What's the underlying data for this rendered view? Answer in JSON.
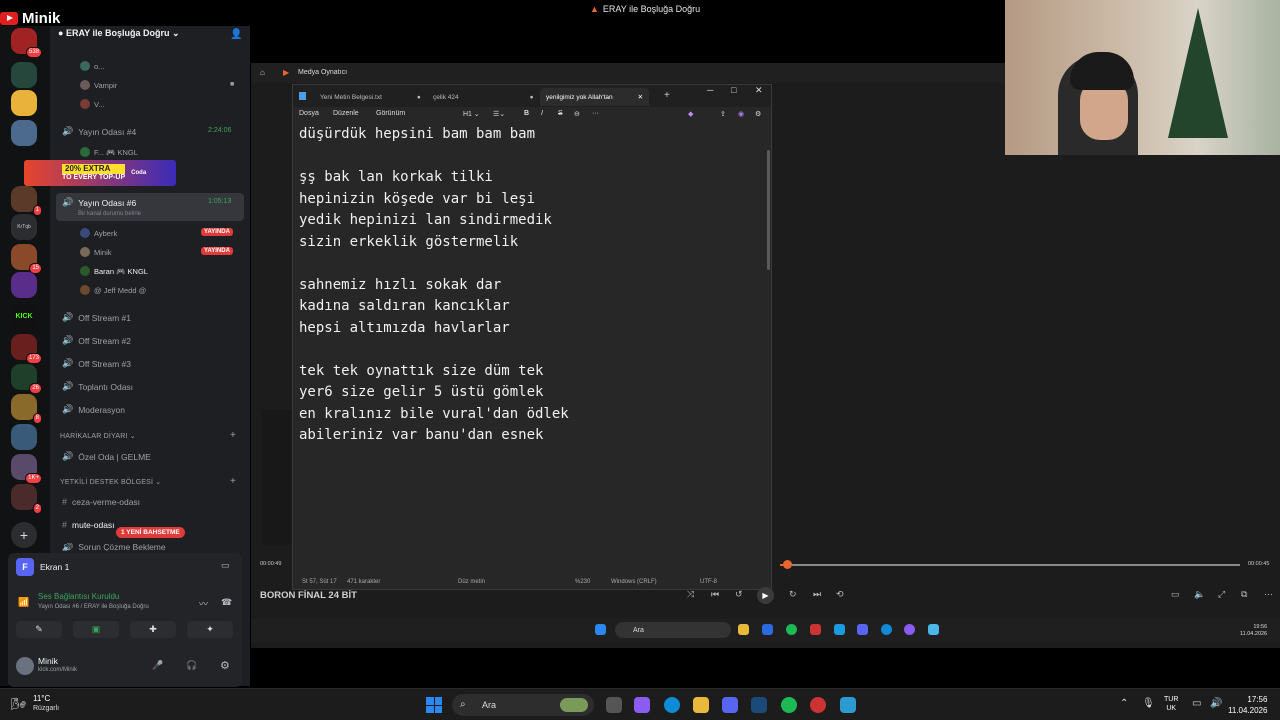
{
  "youtube": {
    "label": "Minik"
  },
  "window_title": "ERAY ile Boşluğa Doğru",
  "discord": {
    "server_name": "ERAY ile Boşluğa Doğru",
    "server_badges": [
      "538",
      "1",
      "15",
      "2",
      "173",
      "26",
      "8",
      "1K+",
      "2"
    ],
    "channels_top_users": [
      "o...",
      "Vampir",
      "V..."
    ],
    "yayin4": {
      "name": "Yayın Odası #4",
      "time": "2:24:06",
      "user": "F... 🎮 KNGL"
    },
    "promo": {
      "big": "20% EXTRA",
      "small": "TO EVERY TOP-UP",
      "brand": "Coda"
    },
    "yayin6": {
      "name": "Yayın Odası #6",
      "time": "1:05:13",
      "status": "Bir kanal durumu belirle"
    },
    "users": [
      {
        "name": "Ayberk",
        "live": "YAYINDA"
      },
      {
        "name": "Minik",
        "live": "YAYINDA"
      },
      {
        "name": "Baran 🎮 KNGL",
        "live": ""
      },
      {
        "name": "@ Jeff Medd @",
        "live": ""
      }
    ],
    "channels": [
      "Off Stream #1",
      "Off Stream #2",
      "Off Stream #3",
      "Toplantı Odası",
      "Moderasyon"
    ],
    "cat1": "HARİKALAR DİYARI",
    "ozel": "Özel Oda | GELME",
    "cat2": "YETKİLİ DESTEK BÖLGESİ",
    "text_channels": [
      "ceza-verme-odası",
      "mute-odası",
      "Sorun Çözme Bekleme"
    ],
    "mute_pill": "1 YENİ BAHSETME",
    "ekran": "Ekran 1",
    "voice_connected": "Ses Bağlantısı Kuruldu",
    "voice_sub": "Yayın Odası #6 / ERAY ile Boşluğa Doğru",
    "user_name": "Minik",
    "user_sub": "kick.com/Minik"
  },
  "media_player": {
    "title": "Medya Oynatıcı",
    "track": "BORON FİNAL 24 BİT",
    "time_start": "00:00:49",
    "time_end": "00:00:45",
    "progress": 0.02
  },
  "notepad": {
    "tabs": [
      "Yeni Metin Belgesi.txt",
      "çelik 424",
      "yenilgimiz yok Allah'tan"
    ],
    "menus": [
      "Dosya",
      "Düzenle",
      "Görünüm"
    ],
    "heading": "H1",
    "lines": [
      "düşürdük hepsini bam bam bam",
      "",
      "şş bak lan korkak tilki",
      "hepinizin köşede var bi leşi",
      "yedik hepinizi lan sindirmedik",
      "sizin erkeklik göstermelik",
      "",
      "sahnemiz hızlı sokak dar",
      "kadına saldıran kancıklar",
      "hepsi altımızda havlarlar",
      "",
      "tek tek oynattık size düm tek",
      "yer6 size gelir 5 üstü gömlek",
      "en kralınız bile vural'dan ödlek",
      "abileriniz var banu'dan esnek"
    ],
    "status": {
      "pos": "St 57, Süt 17",
      "chars": "471 karakter",
      "format": "Düz metin",
      "zoom": "%230",
      "eol": "Windows (CRLF)",
      "enc": "UTF-8"
    }
  },
  "inner_taskbar": {
    "search": "Ara",
    "clock_time": "19:56",
    "clock_date": "11.04.2026"
  },
  "taskbar": {
    "weather_temp": "11°C",
    "weather_desc": "Rüzgarlı",
    "search": "Ara",
    "lang1": "TUR",
    "lang2": "UK",
    "time": "17:56",
    "date": "11.04.2026"
  }
}
